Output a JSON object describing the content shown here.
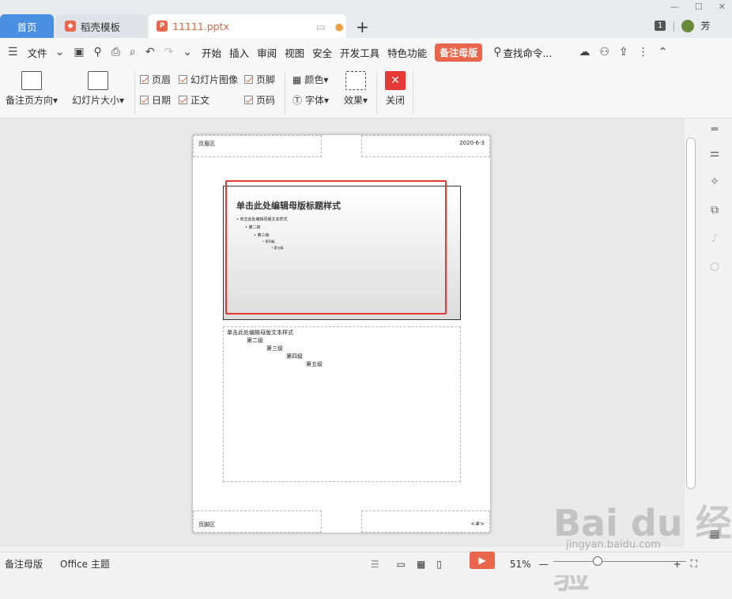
{
  "tabs": {
    "home": "首页",
    "template": "稻壳模板",
    "file": "11111.pptx"
  },
  "user": {
    "badge": "1",
    "name": "芳"
  },
  "menu": {
    "file": "文件",
    "items": [
      "开始",
      "插入",
      "审阅",
      "视图",
      "安全",
      "开发工具",
      "特色功能"
    ],
    "active": "备注母版",
    "search": "查找命令..."
  },
  "ribbon": {
    "notes_orientation": "备注页方向",
    "slide_size": "幻灯片大小",
    "chk_header": "页眉",
    "chk_slide_image": "幻灯片图像",
    "chk_footer": "页脚",
    "chk_date": "日期",
    "chk_body": "正文",
    "chk_page_num": "页码",
    "color": "颜色",
    "font": "字体",
    "effect": "效果",
    "close": "关闭"
  },
  "page": {
    "header": "页眉区",
    "date": "2020-6-3",
    "slide_title": "单击此处编辑母版标题样式",
    "slide_bullets": [
      "单击此处编辑母版文本样式",
      "第二级",
      "第三级",
      "第四级",
      "第五级"
    ],
    "notes": [
      "单击此处编辑母版文本样式",
      "第二级",
      "第三级",
      "第四级",
      "第五级"
    ],
    "footer": "页脚区",
    "page_num": "<#>"
  },
  "status": {
    "mode": "备注母版",
    "theme": "Office 主题",
    "zoom": "51%"
  },
  "watermark": {
    "main": "Bai du 经验",
    "sub": "jingyan.baidu.com"
  }
}
